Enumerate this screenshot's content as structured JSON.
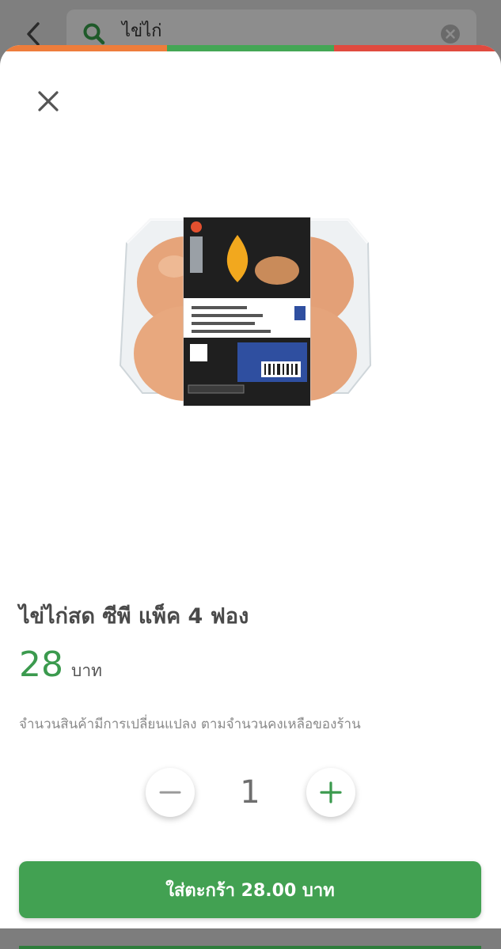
{
  "search": {
    "query": "ไข่ไก่",
    "back_icon": "chevron-left-icon",
    "search_icon": "search-icon",
    "clear_icon": "clear-icon"
  },
  "theme": {
    "accent_green": "#42a152",
    "price_green": "#3b9a4e",
    "stripe_colors": [
      "#ee7d3b",
      "#44a655",
      "#e04a3f"
    ]
  },
  "modal": {
    "close_icon": "close-icon",
    "product": {
      "name": "ไข่ไก่สด ซีพี แพ็ค 4 ฟอง",
      "price": "28",
      "price_unit": "บาท",
      "stock_note": "จำนวนสินค้ามีการเปลี่ยนแปลง ตามจำนวนคงเหลือของร้าน",
      "image_icon": "egg-pack-image"
    },
    "quantity": {
      "value": "1",
      "minus_icon": "minus-icon",
      "plus_icon": "plus-icon"
    },
    "add_to_cart_label": "ใส่ตะกร้า 28.00 บาท"
  }
}
